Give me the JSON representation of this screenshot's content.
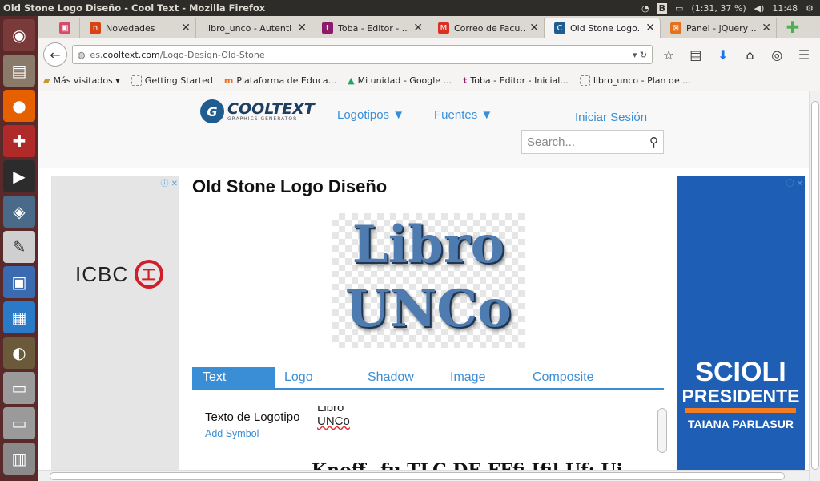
{
  "window": {
    "title": "Old Stone Logo Diseño - Cool Text - Mozilla Firefox"
  },
  "system": {
    "kbd": "B",
    "battery": "(1:31, 37 %)",
    "volume": "◀)",
    "clock": "11:48",
    "power": "⚙"
  },
  "tabs": [
    {
      "label": "Novedades",
      "icon_color": "#d84315",
      "glyph": "n"
    },
    {
      "label": "libro_unco - Autenti...",
      "icon_color": "#ffffff",
      "glyph": ""
    },
    {
      "label": "Toba - Editor - ...",
      "icon_color": "#8e1a6b",
      "glyph": "t"
    },
    {
      "label": "Correo de Facu...",
      "icon_color": "#d93025",
      "glyph": "M"
    },
    {
      "label": "Old Stone Logo...",
      "icon_color": "#1f5c8f",
      "glyph": "C"
    },
    {
      "label": "Panel - jQuery ...",
      "icon_color": "#e8701a",
      "glyph": "⊠"
    }
  ],
  "url": {
    "prefix": "es.",
    "host": "cooltext.com",
    "path": "/Logo-Design-Old-Stone"
  },
  "bookmarks": [
    {
      "label": "Más visitados ▾"
    },
    {
      "label": "Getting Started"
    },
    {
      "label": "Plataforma de Educa..."
    },
    {
      "label": "Mi unidad - Google ..."
    },
    {
      "label": "Toba - Editor - Inicial..."
    },
    {
      "label": "libro_unco - Plan de ..."
    }
  ],
  "site": {
    "logo_text": "COOLTEXT",
    "logo_sub": "GRAPHICS GENERATOR",
    "menu_logotipos": "Logotipos ▼",
    "menu_fuentes": "Fuentes ▼",
    "login": "Iniciar Sesión",
    "search_placeholder": "Search..."
  },
  "page": {
    "title": "Old Stone Logo Diseño",
    "preview_line1": "Libro",
    "preview_line2": "UNCo",
    "editor_tabs": [
      "Text",
      "Logo",
      "Shadow",
      "Image",
      "Composite"
    ],
    "field_label": "Texto de Logotipo",
    "add_symbol": "Add Symbol",
    "text_line1": "Libro",
    "text_line2": "UNCo",
    "below_text": "Knoff--fu TLC DE FFfi Ifil Uf: Ui"
  },
  "ads": {
    "left_brand": "ICBC",
    "left_seal": "工",
    "right_line1": "SCIOLI",
    "right_line2": "PRESIDENTE",
    "right_line3": "TAIANA PARLASUR"
  }
}
